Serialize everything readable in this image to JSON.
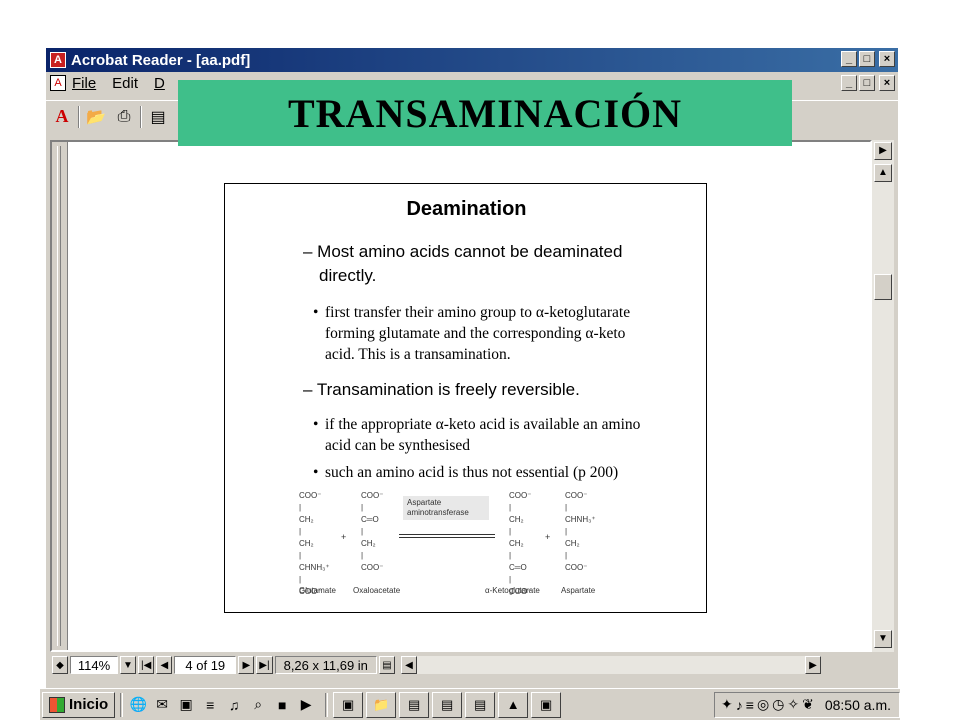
{
  "window": {
    "title": "Acrobat Reader - [aa.pdf]",
    "min_label": "_",
    "max_label": "□",
    "close_label": "×"
  },
  "menu": {
    "items": [
      "File",
      "Edit",
      "D"
    ]
  },
  "banner": {
    "text": "TRANSAMINACIÓN",
    "color": "#3fbf8a"
  },
  "slide": {
    "heading": "Deamination",
    "bullet1_line1": "– Most amino acids cannot be deaminated",
    "bullet1_line2": "directly.",
    "sub1_line1": "first transfer their amino group to α-ketoglutarate",
    "sub1_line2": "forming glutamate and the corresponding α-keto",
    "sub1_line3": "acid. This is a transamination.",
    "bullet2": "– Transamination is freely reversible.",
    "sub2_line1": "if the appropriate α-keto acid is available an amino",
    "sub2_line2": "acid can be synthesised",
    "sub3": "such an amino acid is thus not essential (p 200)",
    "bullet_glyph": "•"
  },
  "diagram": {
    "glutamate": "COO⁻\n|\nCH₂\n|\nCH₂\n|\nCHNH₃⁺\n|\nCOO⁻",
    "oxaloacetate": "COO⁻\n|\nC═O\n|\nCH₂\n|\nCOO⁻",
    "ketoglutarate": "COO⁻\n|\nCH₂\n|\nCH₂\n|\nC═O\n|\nCOO⁻",
    "aspartate": "COO⁻\n|\nCHNH₃⁺\n|\nCH₂\n|\nCOO⁻",
    "enzyme": "Aspartate\naminotransferase",
    "plus": "+",
    "names": [
      "Glutamate",
      "Oxaloacetate",
      "α-Ketoglutarate",
      "Aspartate"
    ]
  },
  "status": {
    "zoom": "114%",
    "page": "4 of 19",
    "size": "8,26 x 11,69 in"
  },
  "taskbar": {
    "start_label": "Inicio",
    "clock": "08:50 a.m."
  }
}
